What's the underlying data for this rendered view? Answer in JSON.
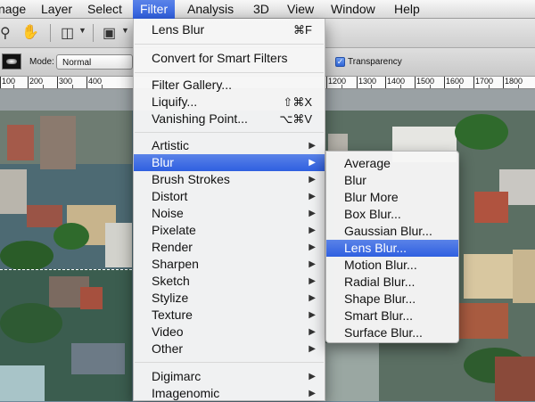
{
  "menubar": {
    "items": [
      "nage",
      "Layer",
      "Select",
      "Filter",
      "Analysis",
      "3D",
      "View",
      "Window",
      "Help"
    ],
    "active_index": 3
  },
  "options": {
    "mode_label": "Mode:",
    "mode_value": "Normal",
    "transparency_label": "Transparency",
    "transparency_checked": true
  },
  "ruler": {
    "labels": [
      "100",
      "200",
      "300",
      "400",
      "1200",
      "1300",
      "1400",
      "1500",
      "1600",
      "1700",
      "1800"
    ]
  },
  "filter_menu": {
    "items": [
      {
        "label": "Lens Blur",
        "shortcut": "⌘F"
      },
      {
        "separator": true
      },
      {
        "label": "Convert for Smart Filters"
      },
      {
        "separator": true
      },
      {
        "label": "Filter Gallery..."
      },
      {
        "label": "Liquify...",
        "shortcut": "⇧⌘X"
      },
      {
        "label": "Vanishing Point...",
        "shortcut": "⌥⌘V"
      },
      {
        "separator": true
      },
      {
        "label": "Artistic",
        "submenu": true
      },
      {
        "label": "Blur",
        "submenu": true,
        "highlighted": true
      },
      {
        "label": "Brush Strokes",
        "submenu": true
      },
      {
        "label": "Distort",
        "submenu": true
      },
      {
        "label": "Noise",
        "submenu": true
      },
      {
        "label": "Pixelate",
        "submenu": true
      },
      {
        "label": "Render",
        "submenu": true
      },
      {
        "label": "Sharpen",
        "submenu": true
      },
      {
        "label": "Sketch",
        "submenu": true
      },
      {
        "label": "Stylize",
        "submenu": true
      },
      {
        "label": "Texture",
        "submenu": true
      },
      {
        "label": "Video",
        "submenu": true
      },
      {
        "label": "Other",
        "submenu": true
      },
      {
        "separator": true
      },
      {
        "label": "Digimarc",
        "submenu": true
      },
      {
        "label": "Imagenomic",
        "submenu": true
      }
    ]
  },
  "blur_submenu": {
    "items": [
      {
        "label": "Average"
      },
      {
        "label": "Blur"
      },
      {
        "label": "Blur More"
      },
      {
        "label": "Box Blur..."
      },
      {
        "label": "Gaussian Blur..."
      },
      {
        "label": "Lens Blur...",
        "highlighted": true
      },
      {
        "label": "Motion Blur..."
      },
      {
        "label": "Radial Blur..."
      },
      {
        "label": "Shape Blur..."
      },
      {
        "label": "Smart Blur..."
      },
      {
        "label": "Surface Blur..."
      }
    ]
  }
}
